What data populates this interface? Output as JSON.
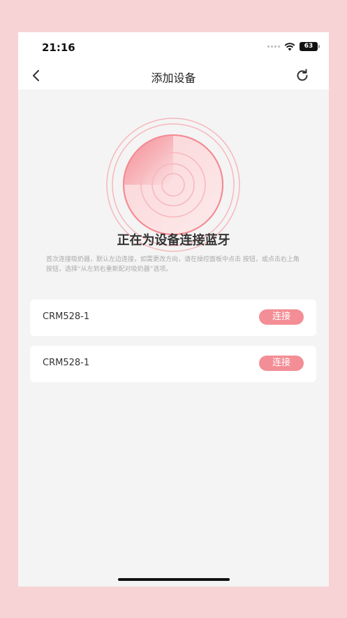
{
  "status_bar": {
    "time": "21:16",
    "battery": "63"
  },
  "nav": {
    "title": "添加设备",
    "back_icon": "chevron-left-icon",
    "refresh_icon": "refresh-icon"
  },
  "main": {
    "title": "正在为设备连接蓝牙",
    "description": "首次连接吸奶器，默认左边连接，如需更改方向，请在操控面板中点击 按钮，或点击右上角 按钮，选择“从左到右重新配对吸奶器”选项。"
  },
  "devices": [
    {
      "name": "CRM528-1",
      "action_label": "连接"
    },
    {
      "name": "CRM528-1",
      "action_label": "连接"
    }
  ],
  "colors": {
    "accent": "#f38e96",
    "background": "#f4f4f4",
    "frame": "#f7d3d6"
  }
}
